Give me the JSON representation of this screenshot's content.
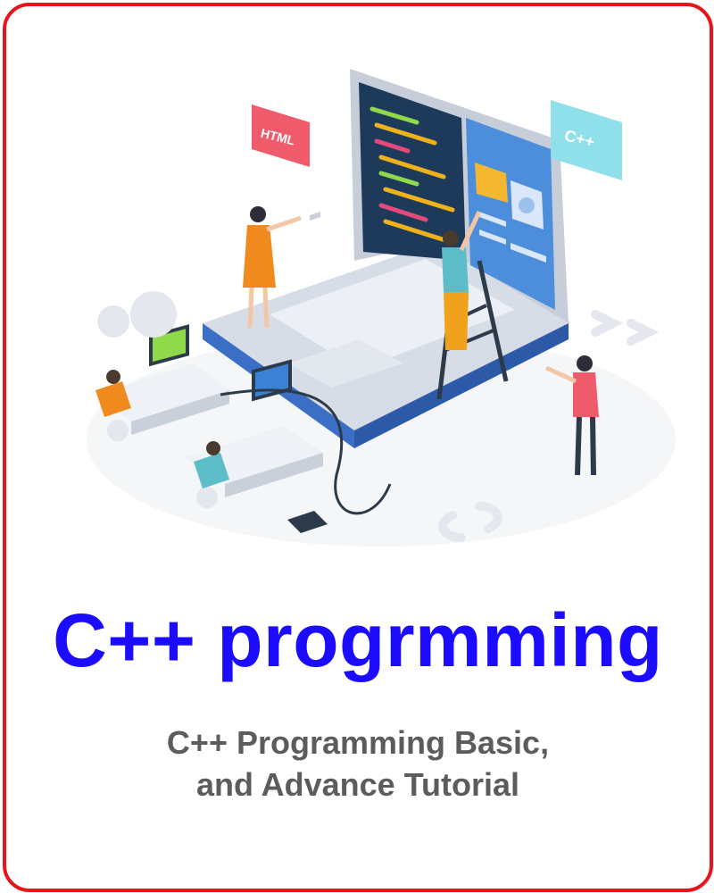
{
  "card": {
    "title": "C++ progrmming",
    "subtitle_line1": "C++ Programming Basic,",
    "subtitle_line2": "and Advance Tutorial",
    "accent_colors": {
      "border": "#e8141b",
      "title": "#1c0cff",
      "subtitle": "#5c5c5c"
    }
  },
  "illustration": {
    "html_badge": "HTML",
    "cpp_badge": "C++"
  }
}
